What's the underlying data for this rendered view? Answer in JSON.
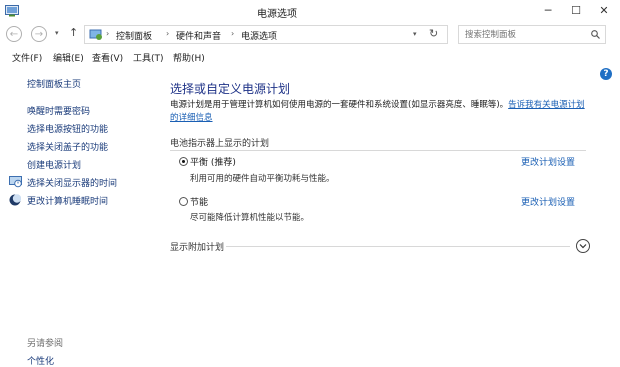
{
  "window": {
    "title": "电源选项",
    "minimize_label": "─",
    "maximize_label": "☐",
    "close_label": "✕"
  },
  "address_bar": {
    "separator": "›",
    "breadcrumbs": [
      "控制面板",
      "硬件和声音",
      "电源选项"
    ],
    "search_placeholder": "搜索控制面板"
  },
  "menu": [
    "文件(F)",
    "编辑(E)",
    "查看(V)",
    "工具(T)",
    "帮助(H)"
  ],
  "sidebar": {
    "home": "控制面板主页",
    "items": [
      "唤醒时需要密码",
      "选择电源按钮的功能",
      "选择关闭盖子的功能",
      "创建电源计划",
      "选择关闭显示器的时间",
      "更改计算机睡眠时间"
    ],
    "see_also_label": "另请参阅",
    "see_also_items": [
      "个性化"
    ]
  },
  "main": {
    "title": "选择或自定义电源计划",
    "intro_text": "电源计划是用于管理计算机如何使用电源的一套硬件和系统设置(如显示器亮度、睡眠等)。",
    "intro_link": "告诉我有关电源计划的详细信息",
    "battery_section_label": "电池指示器上显示的计划",
    "plans": [
      {
        "name": "平衡 (推荐)",
        "description": "利用可用的硬件自动平衡功耗与性能。",
        "change_link": "更改计划设置",
        "selected": true
      },
      {
        "name": "节能",
        "description": "尽可能降低计算机性能以节能。",
        "change_link": "更改计划设置",
        "selected": false
      }
    ],
    "additional_plans_label": "显示附加计划"
  },
  "colors": {
    "link": "#1a5fb4",
    "title": "#1e3287",
    "help_icon": "#1f6fc4"
  },
  "icons": {
    "app": "power-options-icon",
    "back": "back-arrow-icon",
    "forward": "forward-arrow-icon",
    "recent": "chevron-down-icon",
    "up": "up-arrow-icon",
    "location": "control-panel-icon",
    "refresh": "refresh-icon",
    "search": "search-icon",
    "help": "help-icon",
    "expand": "chevron-down-icon"
  }
}
